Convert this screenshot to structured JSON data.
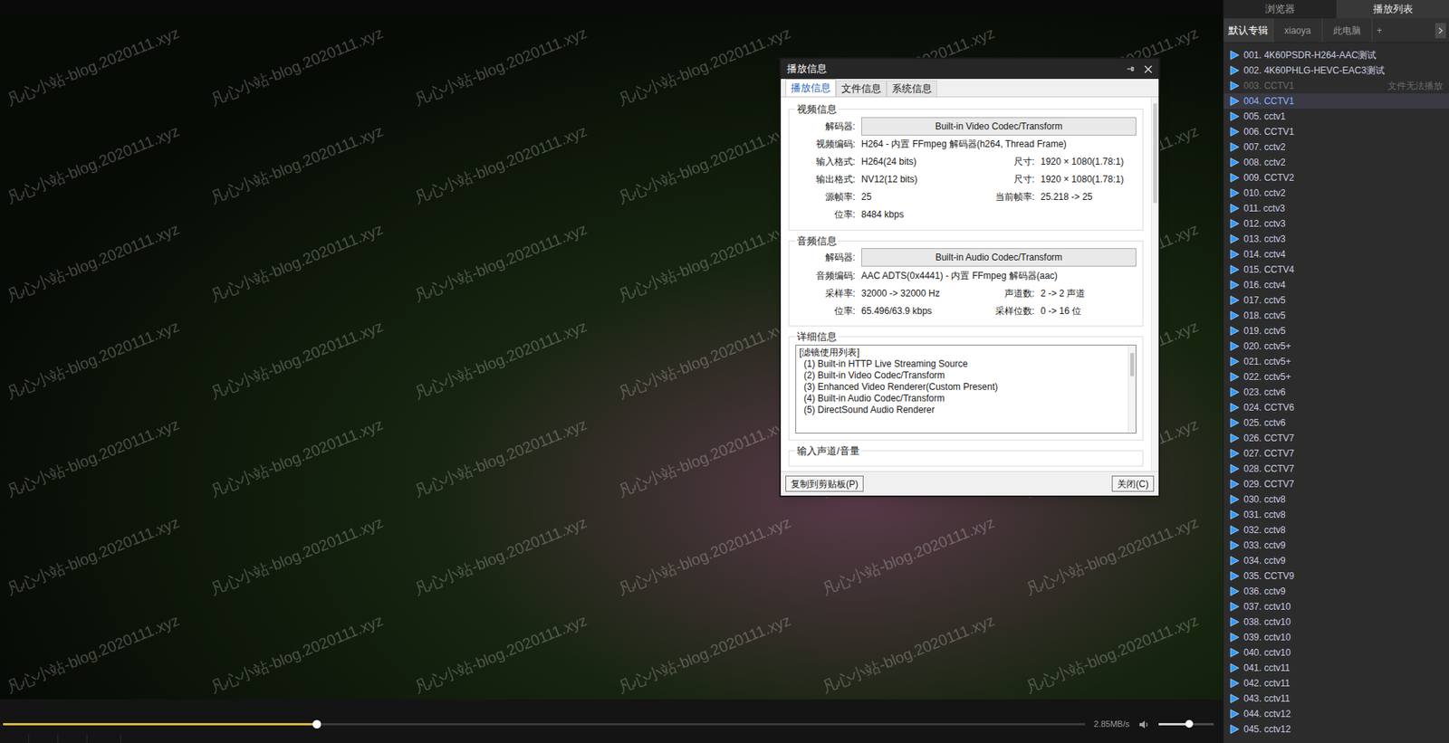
{
  "player": {
    "watermark": "凡心小站-blog.2020111.xyz"
  },
  "dialog": {
    "title": "播放信息",
    "tabs": [
      {
        "label": "播放信息",
        "selected": true
      },
      {
        "label": "文件信息",
        "selected": false
      },
      {
        "label": "系统信息",
        "selected": false
      }
    ],
    "groups": [
      {
        "legend": "视频信息",
        "rows": [
          {
            "kind": "button",
            "label": "解码器:",
            "value": "Built-in Video Codec/Transform"
          },
          {
            "kind": "full",
            "label": "视频编码:",
            "value": "H264 - 内置 FFmpeg 解码器(h264, Thread Frame)"
          },
          {
            "kind": "pair",
            "label": "输入格式:",
            "value": "H264(24 bits)",
            "label2": "尺寸:",
            "value2": "1920 × 1080(1.78:1)"
          },
          {
            "kind": "pair",
            "label": "输出格式:",
            "value": "NV12(12 bits)",
            "label2": "尺寸:",
            "value2": "1920 × 1080(1.78:1)"
          },
          {
            "kind": "pair",
            "label": "源帧率:",
            "value": "25",
            "label2": "当前帧率:",
            "value2": "25.218 -> 25"
          },
          {
            "kind": "full",
            "label": "位率:",
            "value": "8484 kbps"
          }
        ]
      },
      {
        "legend": "音频信息",
        "rows": [
          {
            "kind": "button",
            "label": "解码器:",
            "value": "Built-in Audio Codec/Transform"
          },
          {
            "kind": "full",
            "label": "音频编码:",
            "value": "AAC ADTS(0x4441) - 内置 FFmpeg 解码器(aac)"
          },
          {
            "kind": "pair",
            "label": "采样率:",
            "value": "32000 -> 32000 Hz",
            "label2": "声道数:",
            "value2": "2 -> 2 声道"
          },
          {
            "kind": "pair",
            "label": "位率:",
            "value": "65.496/63.9 kbps",
            "label2": "采样位数:",
            "value2": "0 -> 16 位"
          }
        ]
      }
    ],
    "details": {
      "legend": "详细信息",
      "lines": [
        "[滤镜使用列表]",
        "(1) Built-in HTTP Live Streaming Source",
        "(2) Built-in Video Codec/Transform",
        "(3) Enhanced Video Renderer(Custom Present)",
        "(4) Built-in Audio Codec/Transform",
        "(5) DirectSound Audio Renderer"
      ]
    },
    "next_legend": "输入声道/音量",
    "buttons": [
      "复制到剪贴板(P)",
      "关闭(C)"
    ]
  },
  "controls": {
    "seek_level": 0.29,
    "speed": "2.85MB/s",
    "volume_level": 0.55
  },
  "playlist_panel": {
    "tabs": [
      {
        "label": "浏览器",
        "selected": false
      },
      {
        "label": "播放列表",
        "selected": true
      }
    ],
    "albums": [
      {
        "label": "默认专辑",
        "selected": true
      },
      {
        "label": "xiaoya",
        "selected": false
      },
      {
        "label": "此电脑",
        "selected": false
      }
    ],
    "album_add": "+",
    "items": [
      {
        "label": "001. 4K60PSDR-H264-AAC测试",
        "selected": false,
        "disabled": false,
        "status": ""
      },
      {
        "label": "002. 4K60PHLG-HEVC-EAC3测试",
        "selected": false,
        "disabled": false,
        "status": ""
      },
      {
        "label": "003. CCTV1",
        "selected": false,
        "disabled": true,
        "status": "文件无法播放"
      },
      {
        "label": "004. CCTV1",
        "selected": true,
        "disabled": false,
        "status": ""
      },
      {
        "label": "005. cctv1",
        "selected": false,
        "disabled": false,
        "status": ""
      },
      {
        "label": "006. CCTV1",
        "selected": false,
        "disabled": false,
        "status": ""
      },
      {
        "label": "007. cctv2",
        "selected": false,
        "disabled": false,
        "status": ""
      },
      {
        "label": "008. cctv2",
        "selected": false,
        "disabled": false,
        "status": ""
      },
      {
        "label": "009. CCTV2",
        "selected": false,
        "disabled": false,
        "status": ""
      },
      {
        "label": "010. cctv2",
        "selected": false,
        "disabled": false,
        "status": ""
      },
      {
        "label": "011. cctv3",
        "selected": false,
        "disabled": false,
        "status": ""
      },
      {
        "label": "012. cctv3",
        "selected": false,
        "disabled": false,
        "status": ""
      },
      {
        "label": "013. cctv3",
        "selected": false,
        "disabled": false,
        "status": ""
      },
      {
        "label": "014. cctv4",
        "selected": false,
        "disabled": false,
        "status": ""
      },
      {
        "label": "015. CCTV4",
        "selected": false,
        "disabled": false,
        "status": ""
      },
      {
        "label": "016. cctv4",
        "selected": false,
        "disabled": false,
        "status": ""
      },
      {
        "label": "017. cctv5",
        "selected": false,
        "disabled": false,
        "status": ""
      },
      {
        "label": "018. cctv5",
        "selected": false,
        "disabled": false,
        "status": ""
      },
      {
        "label": "019. cctv5",
        "selected": false,
        "disabled": false,
        "status": ""
      },
      {
        "label": "020. cctv5+",
        "selected": false,
        "disabled": false,
        "status": ""
      },
      {
        "label": "021. cctv5+",
        "selected": false,
        "disabled": false,
        "status": ""
      },
      {
        "label": "022. cctv5+",
        "selected": false,
        "disabled": false,
        "status": ""
      },
      {
        "label": "023. cctv6",
        "selected": false,
        "disabled": false,
        "status": ""
      },
      {
        "label": "024. CCTV6",
        "selected": false,
        "disabled": false,
        "status": ""
      },
      {
        "label": "025. cctv6",
        "selected": false,
        "disabled": false,
        "status": ""
      },
      {
        "label": "026. CCTV7",
        "selected": false,
        "disabled": false,
        "status": ""
      },
      {
        "label": "027. CCTV7",
        "selected": false,
        "disabled": false,
        "status": ""
      },
      {
        "label": "028. CCTV7",
        "selected": false,
        "disabled": false,
        "status": ""
      },
      {
        "label": "029. CCTV7",
        "selected": false,
        "disabled": false,
        "status": ""
      },
      {
        "label": "030. cctv8",
        "selected": false,
        "disabled": false,
        "status": ""
      },
      {
        "label": "031. cctv8",
        "selected": false,
        "disabled": false,
        "status": ""
      },
      {
        "label": "032. cctv8",
        "selected": false,
        "disabled": false,
        "status": ""
      },
      {
        "label": "033. cctv9",
        "selected": false,
        "disabled": false,
        "status": ""
      },
      {
        "label": "034. cctv9",
        "selected": false,
        "disabled": false,
        "status": ""
      },
      {
        "label": "035. CCTV9",
        "selected": false,
        "disabled": false,
        "status": ""
      },
      {
        "label": "036. cctv9",
        "selected": false,
        "disabled": false,
        "status": ""
      },
      {
        "label": "037. cctv10",
        "selected": false,
        "disabled": false,
        "status": ""
      },
      {
        "label": "038. cctv10",
        "selected": false,
        "disabled": false,
        "status": ""
      },
      {
        "label": "039. cctv10",
        "selected": false,
        "disabled": false,
        "status": ""
      },
      {
        "label": "040. cctv10",
        "selected": false,
        "disabled": false,
        "status": ""
      },
      {
        "label": "041. cctv11",
        "selected": false,
        "disabled": false,
        "status": ""
      },
      {
        "label": "042. cctv11",
        "selected": false,
        "disabled": false,
        "status": ""
      },
      {
        "label": "043. cctv11",
        "selected": false,
        "disabled": false,
        "status": ""
      },
      {
        "label": "044. cctv12",
        "selected": false,
        "disabled": false,
        "status": ""
      },
      {
        "label": "045. cctv12",
        "selected": false,
        "disabled": false,
        "status": ""
      }
    ]
  }
}
